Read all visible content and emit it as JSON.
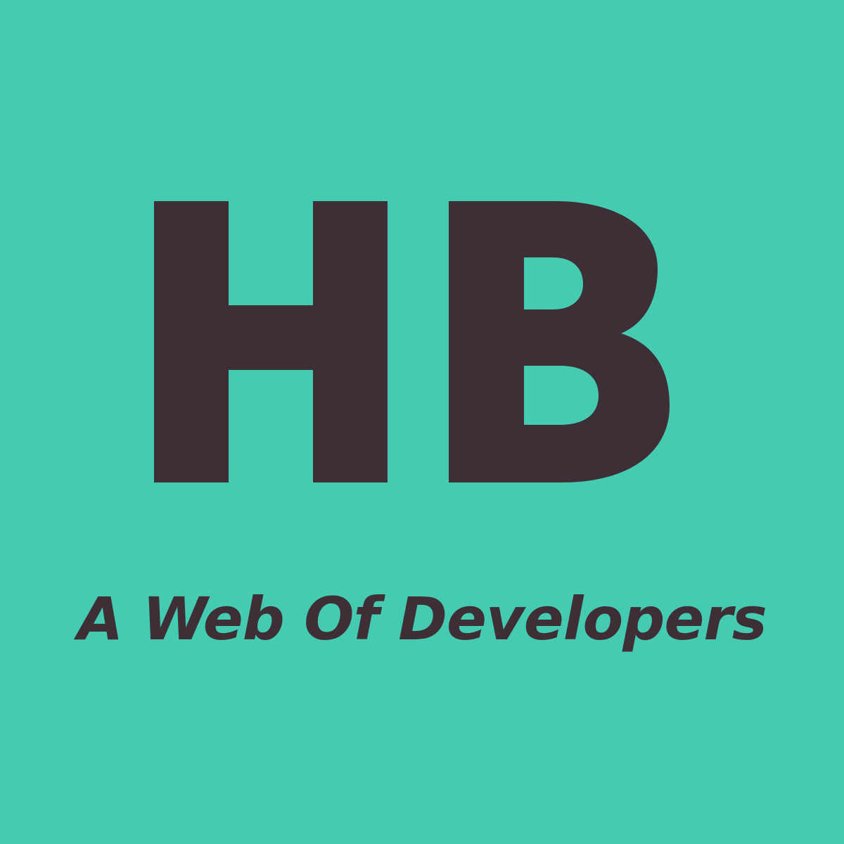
{
  "logo": {
    "monogram": "HB",
    "tagline": "A Web Of Developers"
  },
  "colors": {
    "background": "#45CBB2",
    "foreground": "#3D2F35"
  }
}
